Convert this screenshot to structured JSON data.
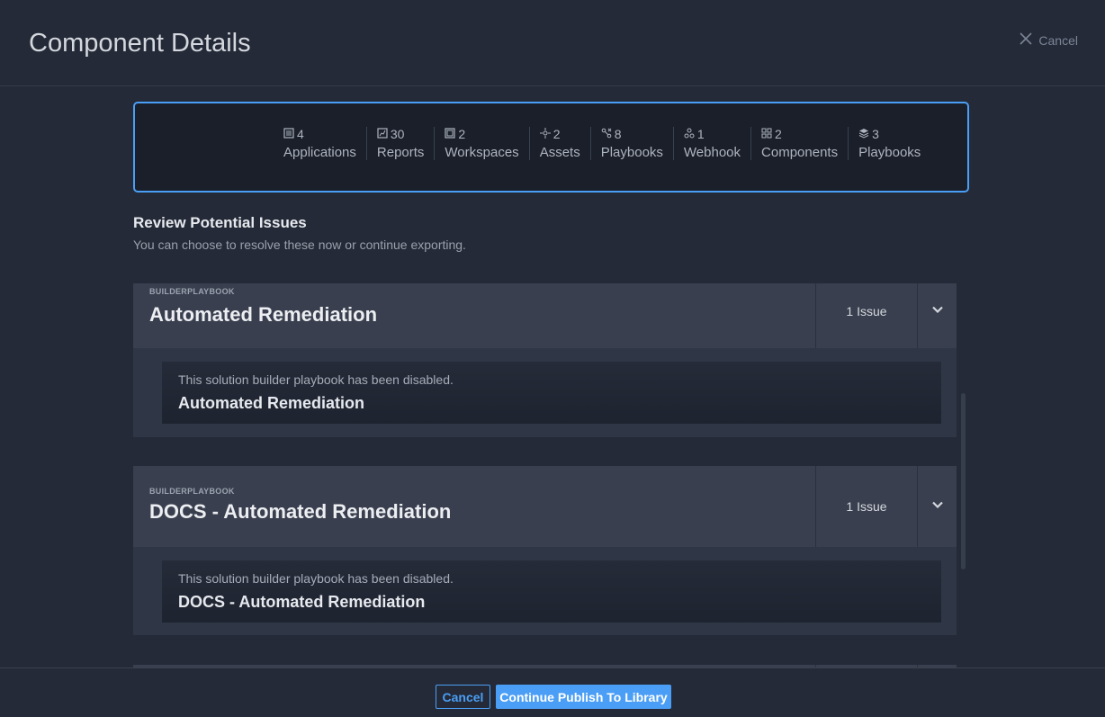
{
  "header": {
    "title": "Component Details",
    "cancel_label": "Cancel"
  },
  "summary": {
    "items": [
      {
        "count": "4",
        "label": "Applications",
        "icon": "applications-icon"
      },
      {
        "count": "30",
        "label": "Reports",
        "icon": "reports-icon"
      },
      {
        "count": "2",
        "label": "Workspaces",
        "icon": "workspaces-icon"
      },
      {
        "count": "2",
        "label": "Assets",
        "icon": "assets-icon"
      },
      {
        "count": "8",
        "label": "Playbooks",
        "icon": "playbooks-icon"
      },
      {
        "count": "1",
        "label": "Webhook",
        "icon": "webhook-icon"
      },
      {
        "count": "2",
        "label": "Components",
        "icon": "components-icon"
      },
      {
        "count": "3",
        "label": "Playbooks",
        "icon": "layers-icon"
      }
    ]
  },
  "review": {
    "title": "Review Potential Issues",
    "subtitle": "You can choose to resolve these now or continue exporting."
  },
  "issues": [
    {
      "type": "BUILDERPLAYBOOK",
      "title": "Automated Remediation",
      "issue_count": "1 Issue",
      "message": "This solution builder playbook has been disabled.",
      "item_name": "Automated Remediation"
    },
    {
      "type": "BUILDERPLAYBOOK",
      "title": "DOCS - Automated Remediation",
      "issue_count": "1 Issue",
      "message": "This solution builder playbook has been disabled.",
      "item_name": "DOCS - Automated Remediation"
    }
  ],
  "footer": {
    "cancel_label": "Cancel",
    "continue_label": "Continue Publish To Library"
  },
  "colors": {
    "accent": "#4b9ef5",
    "background": "#242a37",
    "card_header": "#393f4e"
  }
}
